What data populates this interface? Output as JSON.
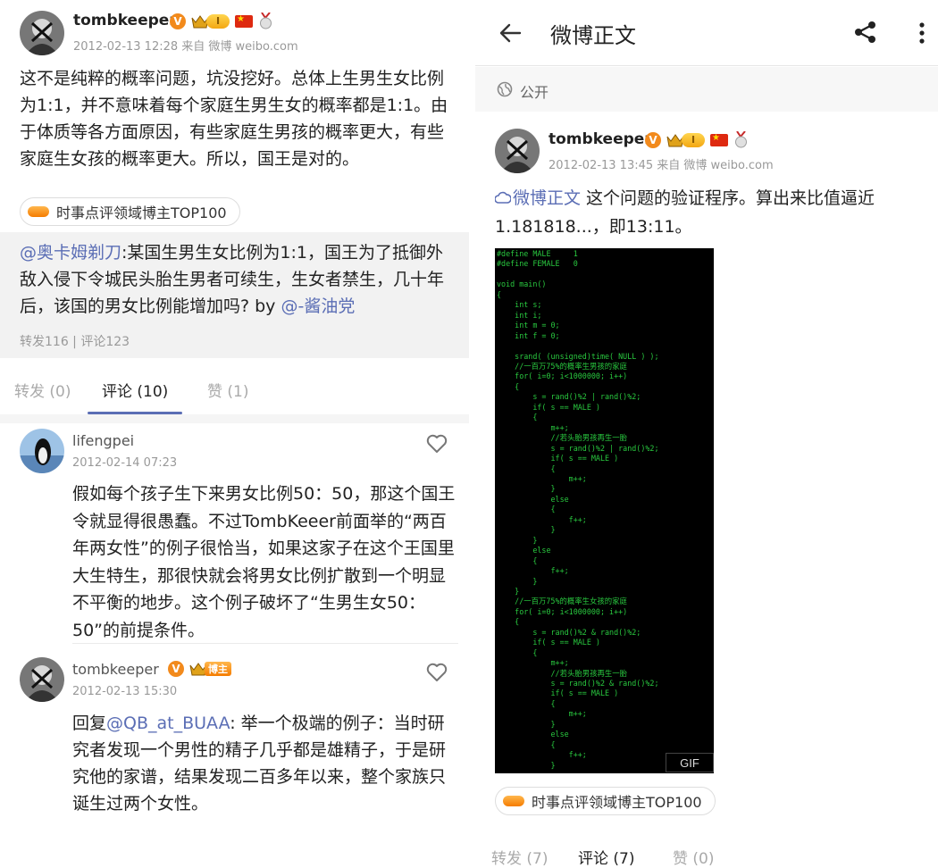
{
  "left": {
    "post": {
      "author": "tombkeeper",
      "level": "I",
      "meta": "2012-02-13 12:28  来自 微博 weibo.com",
      "text": "这不是纯粹的概率问题，坑没挖好。总体上生男生女比例为1:1，并不意味着每个家庭生男生女的概率都是1:1。由于体质等各方面原因，有些家庭生男孩的概率更大，有些家庭生女孩的概率更大。所以，国王是对的。",
      "chip": "时事点评领域博主TOP100"
    },
    "repost": {
      "mention": "@奥卡姆剃刀",
      "text": ":某国生男生女比例为1:1，国王为了抵御外敌入侵下令城民头胎生男者可续生，生女者禁生，几十年后，该国的男女比例能增加吗? by ",
      "by": "@-酱油党",
      "stats": "转发116 | 评论123"
    },
    "tabs": [
      "转发 (0)",
      "评论 (10)",
      "赞 (1)"
    ],
    "comments": [
      {
        "author": "lifengpei",
        "time": "2012-02-14 07:23",
        "text": "假如每个孩子生下来男女比例50：50，那这个国王令就显得很愚蠢。不过TombKeeer前面举的“两百年两女性”的例子很恰当，如果这家子在这个王国里大生特生，那很快就会将男女比例扩散到一个明显不平衡的地步。这个例子破坏了“生男生女50：50”的前提条件。"
      },
      {
        "author": "tombkeeper",
        "badge": "博主",
        "time": "2012-02-13 15:30",
        "reply_prefix": "回复",
        "reply_to": "@QB_at_BUAA",
        "text": ": 举一个极端的例子：当时研究者发现一个男性的精子几乎都是雄精子，于是研究他的家谱，结果发现二百多年以来，整个家族只诞生过两个女性。"
      }
    ]
  },
  "right": {
    "topbar": {
      "title": "微博正文"
    },
    "visibility": "公开",
    "post": {
      "author": "tombkeeper",
      "level": "I",
      "meta": "2012-02-13 13:45  来自 微博 weibo.com",
      "link": "微博正文",
      "text": " 这个问题的验证程序。算出来比值逼近1.181818...，即13:11。",
      "gif_label": "GIF",
      "chip": "时事点评领域博主TOP100"
    },
    "code": "#define MALE     1\n#define FEMALE   0\n\nvoid main()\n{\n    int s;\n    int i;\n    int m = 0;\n    int f = 0;\n\n    srand( (unsigned)time( NULL ) );\n    //一百万75%的概率生男孩的家庭\n    for( i=0; i<1000000; i++)\n    {\n        s = rand()%2 | rand()%2;\n        if( s == MALE )\n        {\n            m++;\n            //若头胎男孩再生一胎\n            s = rand()%2 | rand()%2;\n            if( s == MALE )\n            {\n                m++;\n            }\n            else\n            {\n                f++;\n            }\n        }\n        else\n        {\n            f++;\n        }\n    }\n    //一百万75%的概率生女孩的家庭\n    for( i=0; i<1000000; i++)\n    {\n        s = rand()%2 & rand()%2;\n        if( s == MALE )\n        {\n            m++;\n            //若头胎男孩再生一胎\n            s = rand()%2 & rand()%2;\n            if( s == MALE )\n            {\n                m++;\n            }\n            else\n            {\n                f++;\n            }",
    "tabs": [
      "转发 (7)",
      "评论 (7)",
      "赞 (0)"
    ]
  },
  "icons": {
    "back": "arrow-left-icon",
    "share": "share-icon",
    "more": "more-vertical-icon",
    "globe": "globe-icon",
    "heart": "heart-outline-icon",
    "link": "link-icon"
  },
  "colors": {
    "link": "#5b6eb5",
    "verified": "#f28a1c",
    "code_bg": "#000000",
    "code_fg": "#29c83f",
    "repost_bg": "#f2f2f2"
  }
}
